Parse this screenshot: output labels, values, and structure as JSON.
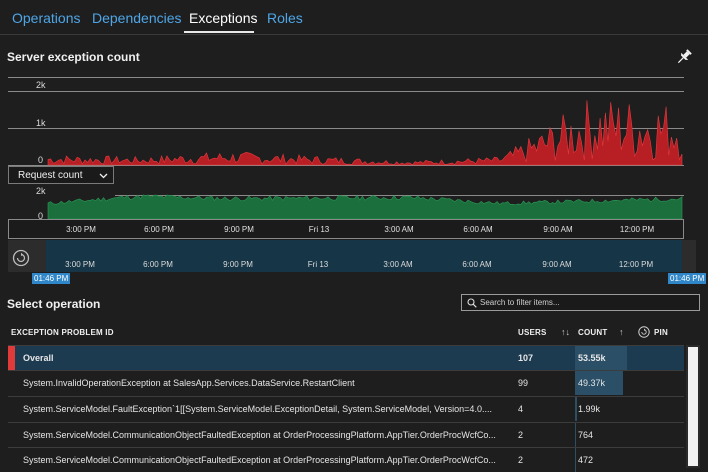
{
  "tabs": [
    {
      "label": "Operations",
      "active": false
    },
    {
      "label": "Dependencies",
      "active": false
    },
    {
      "label": "Exceptions",
      "active": true
    },
    {
      "label": "Roles",
      "active": false
    }
  ],
  "chart": {
    "title": "Server exception count",
    "pin_icon": "pin-icon",
    "metric_dropdown": "Request count",
    "top_ticks": [
      "2k",
      "1k",
      "0"
    ],
    "bottom_ticks": [
      "2k",
      "0"
    ],
    "x_labels": [
      "3:00 PM",
      "6:00 PM",
      "9:00 PM",
      "Fri 13",
      "3:00 AM",
      "6:00 AM",
      "9:00 AM",
      "12:00 PM"
    ],
    "range_start": "01:46 PM",
    "range_end": "01:46 PM",
    "colors": {
      "exceptions": "#c1262b",
      "requests": "#1e7a43",
      "range": "#163546"
    }
  },
  "chart_data": [
    {
      "type": "area",
      "title": "Server exception count",
      "ylim": [
        0,
        2000
      ],
      "x": [
        "3:00 PM",
        "6:00 PM",
        "9:00 PM",
        "Fri 13",
        "3:00 AM",
        "6:00 AM",
        "9:00 AM",
        "12:00 PM"
      ],
      "series": [
        {
          "values": [
            150,
            120,
            200,
            130,
            60,
            120,
            1000,
            900
          ]
        }
      ]
    },
    {
      "type": "area",
      "title": "Request count",
      "ylim": [
        0,
        2000
      ],
      "x": [
        "3:00 PM",
        "6:00 PM",
        "9:00 PM",
        "Fri 13",
        "3:00 AM",
        "6:00 AM",
        "9:00 AM",
        "12:00 PM"
      ],
      "series": [
        {
          "values": [
            1300,
            1900,
            1700,
            1750,
            1800,
            1300,
            1500,
            1700
          ]
        }
      ]
    }
  ],
  "operations": {
    "title": "Select operation",
    "filter_placeholder": "Search to filter items...",
    "columns": {
      "problem": "EXCEPTION PROBLEM ID",
      "users": "USERS",
      "count": "COUNT",
      "pin": "PIN"
    },
    "rows": [
      {
        "name": "Overall",
        "users": "107",
        "count": "53.55k",
        "count_value": 53550
      },
      {
        "name": "System.InvalidOperationException at SalesApp.Services.DataService.RestartClient",
        "users": "99",
        "count": "49.37k",
        "count_value": 49370
      },
      {
        "name": "System.ServiceModel.FaultException`1[[System.ServiceModel.ExceptionDetail, System.ServiceModel, Version=4.0....",
        "users": "4",
        "count": "1.99k",
        "count_value": 1990
      },
      {
        "name": "System.ServiceModel.CommunicationObjectFaultedException at OrderProcessingPlatform.AppTier.OrderProcWcfCo...",
        "users": "2",
        "count": "764",
        "count_value": 764
      },
      {
        "name": "System.ServiceModel.CommunicationObjectFaultedException at OrderProcessingPlatform.AppTier.OrderProcWcfCo...",
        "users": "2",
        "count": "472",
        "count_value": 472
      }
    ]
  }
}
